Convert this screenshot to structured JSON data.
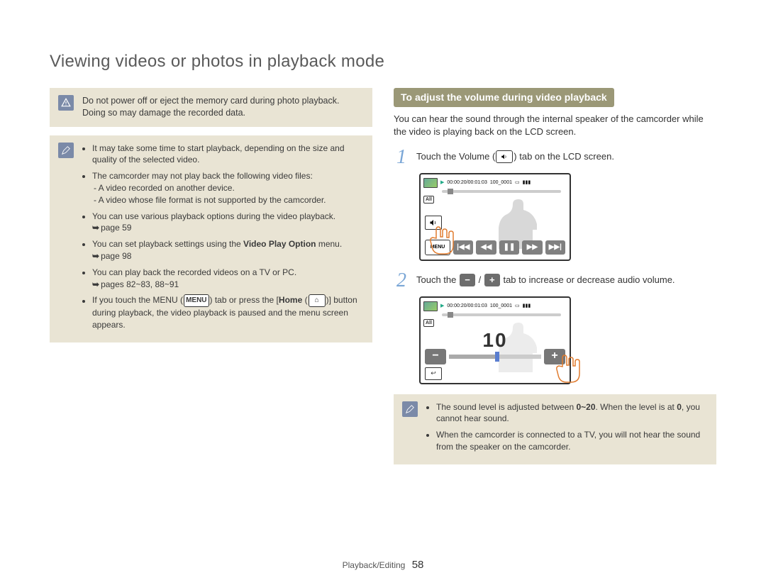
{
  "title": "Viewing videos or photos in playback mode",
  "warning": {
    "line1": "Do not power off or eject the memory card during photo playback.",
    "line2": "Doing so may damage the recorded data."
  },
  "notes_left": {
    "items": [
      {
        "text": "It may take some time to start playback, depending on the size and quality of the selected video."
      },
      {
        "text": "The camcorder may not play back the following video files:",
        "sub": [
          "- A video recorded on another device.",
          "- A video whose file format is not supported by the camcorder."
        ]
      },
      {
        "text": "You can use various playback options during the video playback.",
        "page_ref": "page 59"
      },
      {
        "text_pre": "You can set playback settings using the ",
        "bold": "Video Play Option",
        "text_post": " menu.",
        "page_ref": "page 98"
      },
      {
        "text": "You can play back the recorded videos on a TV or PC.",
        "page_ref": "pages 82~83, 88~91"
      },
      {
        "text_pre": "If you touch the MENU (",
        "menu_icon": "MENU",
        "text_mid": ") tab or press the [",
        "bold": "Home",
        "home_icon": "⌂",
        "text_post": ")] button during playback, the video playback is paused and  the menu screen appears."
      }
    ]
  },
  "section_heading": "To adjust the volume during video playback",
  "intro": "You can hear the sound through the internal speaker of the camcorder while the video is playing back on the LCD screen.",
  "steps": [
    {
      "num": "1",
      "text_pre": "Touch the Volume (",
      "icon": "speaker",
      "text_post": ") tab on the LCD screen."
    },
    {
      "num": "2",
      "text_pre": "Touch the ",
      "minus_icon": "−",
      "slash": " / ",
      "plus_icon": "+",
      "text_post": "  tab to increase or decrease audio volume."
    }
  ],
  "lcd": {
    "timecode": "00:00:20/00:01:03",
    "clip": "100_0001",
    "tag_all": "All",
    "menu": "MENU",
    "volume_value": "10",
    "controls": {
      "rwFull": "|◀◀",
      "rw": "◀◀",
      "pause": "❚❚",
      "ff": "▶▶",
      "ffFull": "▶▶|"
    }
  },
  "notes_right": {
    "items": [
      {
        "text_pre": "The sound level is adjusted between ",
        "bold1": "0~20",
        "text_mid": ". When the level is at ",
        "bold2": "0",
        "text_post": ", you cannot hear sound."
      },
      {
        "text": "When the camcorder is connected to a TV, you will not hear the sound from the speaker on the camcorder."
      }
    ]
  },
  "footer": {
    "section": "Playback/Editing",
    "page": "58"
  }
}
